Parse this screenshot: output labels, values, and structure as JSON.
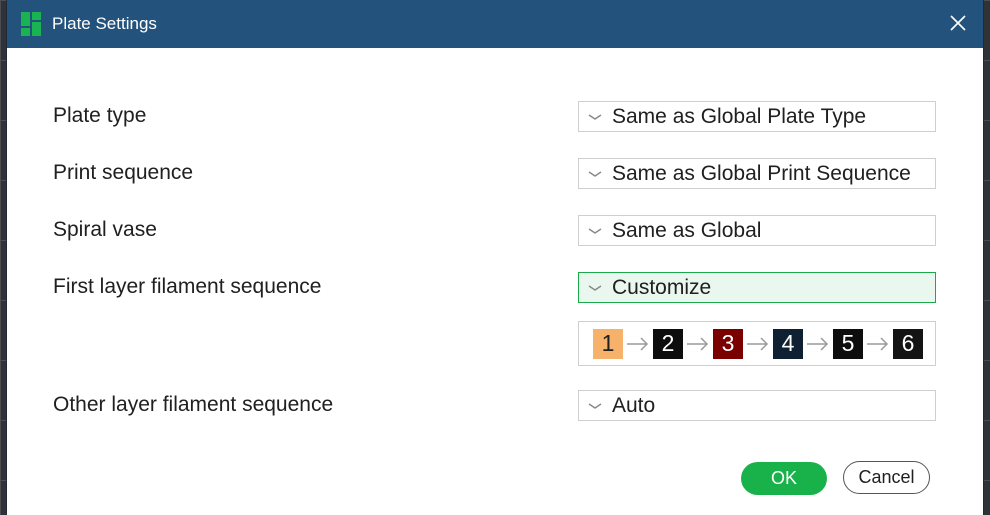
{
  "window": {
    "title": "Plate Settings"
  },
  "rows": {
    "plate_type": {
      "label": "Plate type",
      "value": "Same as Global Plate Type"
    },
    "print_sequence": {
      "label": "Print sequence",
      "value": "Same as Global Print Sequence"
    },
    "spiral_vase": {
      "label": "Spiral vase",
      "value": "Same as Global"
    },
    "first_layer": {
      "label": "First layer filament sequence",
      "value": "Customize"
    },
    "other_layer": {
      "label": "Other layer filament sequence",
      "value": "Auto"
    }
  },
  "filament_sequence": [
    {
      "label": "1",
      "color": "#f6b26b",
      "text_color": "#202020"
    },
    {
      "label": "2",
      "color": "#0d0d0d",
      "text_color": "#ffffff"
    },
    {
      "label": "3",
      "color": "#7a0000",
      "text_color": "#ffffff"
    },
    {
      "label": "4",
      "color": "#0f2033",
      "text_color": "#ffffff"
    },
    {
      "label": "5",
      "color": "#0d0d0d",
      "text_color": "#ffffff"
    },
    {
      "label": "6",
      "color": "#141414",
      "text_color": "#ffffff"
    }
  ],
  "buttons": {
    "ok": "OK",
    "cancel": "Cancel"
  },
  "colors": {
    "titlebar": "#23537c",
    "accent_green": "#19b24a"
  }
}
